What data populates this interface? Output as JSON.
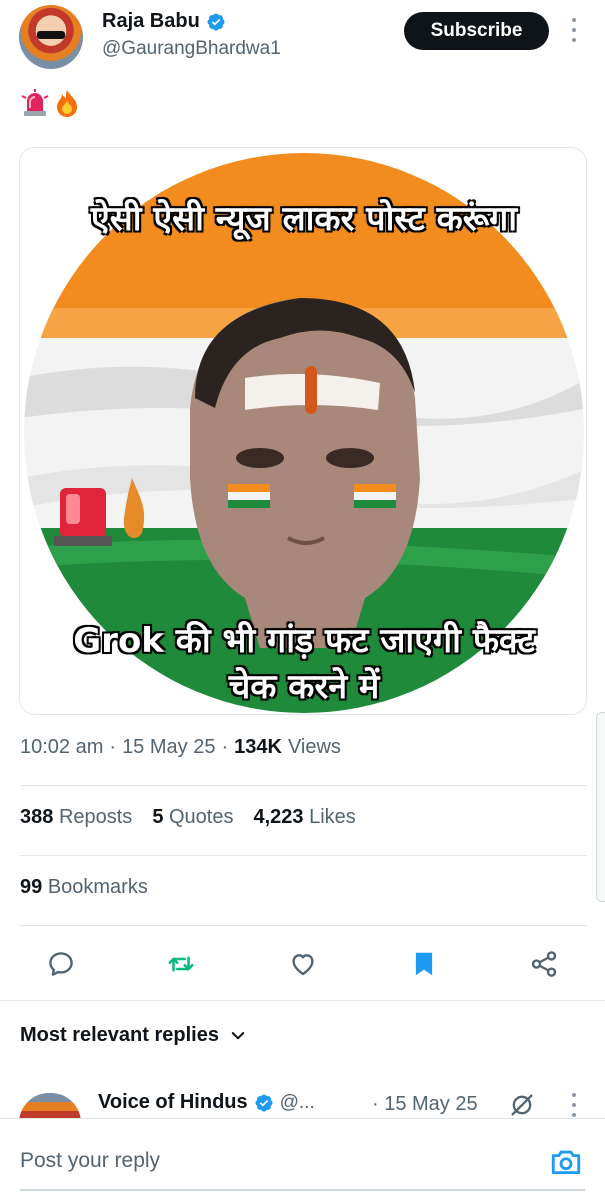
{
  "author": {
    "name": "Raja Babu",
    "handle": "@GaurangBhardwa1",
    "verified": true
  },
  "header": {
    "subscribe_label": "Subscribe",
    "more_icon": "more-vertical-icon"
  },
  "tweet": {
    "emojis": [
      "rotating-light-emoji",
      "fire-emoji"
    ],
    "image": {
      "caption_top": "ऐसी ऐसी न्यूज लाकर पोस्ट करूंगा",
      "caption_bottom_line1": "Grok की भी गांड़ फट जाएगी फैक्ट",
      "caption_bottom_line2": "चेक करने में"
    },
    "time": "10:02 am",
    "date": "15 May 25",
    "views_count": "134K",
    "views_label": "Views",
    "separator": "·"
  },
  "stats": {
    "reposts_count": "388",
    "reposts_label": "Reposts",
    "quotes_count": "5",
    "quotes_label": "Quotes",
    "likes_count": "4,223",
    "likes_label": "Likes",
    "bookmarks_count": "99",
    "bookmarks_label": "Bookmarks"
  },
  "actions": {
    "reply_icon": "reply-icon",
    "repost_icon": "repost-icon",
    "like_icon": "heart-icon",
    "bookmark_icon": "bookmark-icon",
    "share_icon": "share-icon"
  },
  "colors": {
    "text_primary": "#0f1419",
    "text_secondary": "#536471",
    "verified_blue": "#1d9bf0",
    "repost_green": "#00ba7c",
    "saffron": "#f28c1e",
    "india_green": "#1f8a3a"
  },
  "replies": {
    "sort_label": "Most relevant replies",
    "first_reply": {
      "name": "Voice of Hindus",
      "handle": "@...",
      "date": "· 15 May 25"
    }
  },
  "composer": {
    "placeholder": "Post your reply"
  }
}
